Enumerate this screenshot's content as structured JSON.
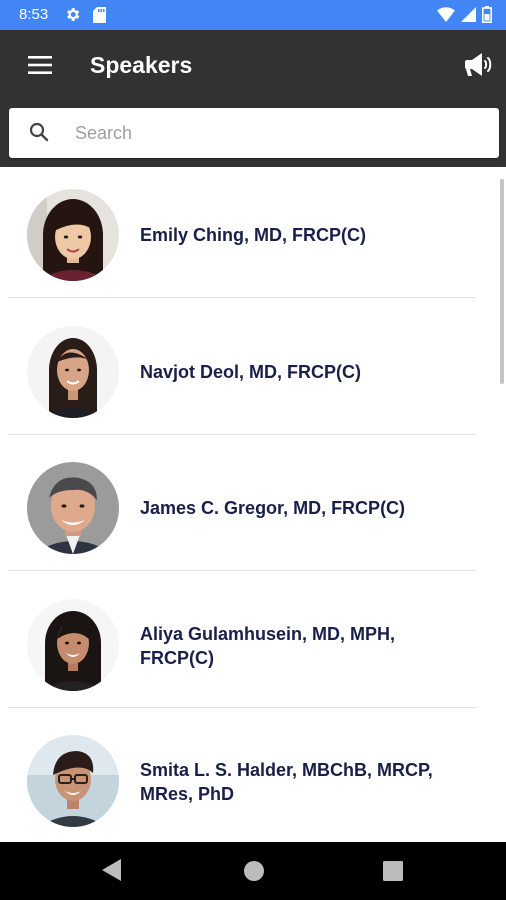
{
  "status_bar": {
    "time": "8:53",
    "icons": [
      "settings-icon",
      "sd-card-icon",
      "wifi-icon",
      "cell-signal-icon",
      "battery-icon"
    ]
  },
  "app_bar": {
    "title": "Speakers",
    "menu_icon": "hamburger-menu-icon",
    "action_icon": "megaphone-icon"
  },
  "search": {
    "placeholder": "Search",
    "value": ""
  },
  "speakers": [
    {
      "name": "Emily Ching, MD, FRCP(C)",
      "avatar": "speaker-photo"
    },
    {
      "name": "Navjot Deol, MD, FRCP(C)",
      "avatar": "speaker-photo"
    },
    {
      "name": "James C. Gregor, MD, FRCP(C)",
      "avatar": "speaker-photo"
    },
    {
      "name": "Aliya Gulamhusein, MD, MPH, FRCP(C)",
      "avatar": "speaker-photo"
    },
    {
      "name": "Smita L. S. Halder, MBChB, MRCP, MRes, PhD",
      "avatar": "speaker-photo"
    }
  ],
  "nav_bar": {
    "icons": [
      "back-icon",
      "home-icon",
      "recents-icon"
    ]
  },
  "colors": {
    "status_bar": "#4285f4",
    "app_bar": "#323232",
    "name_text": "#1a1f4a",
    "nav_bar": "#000000"
  }
}
